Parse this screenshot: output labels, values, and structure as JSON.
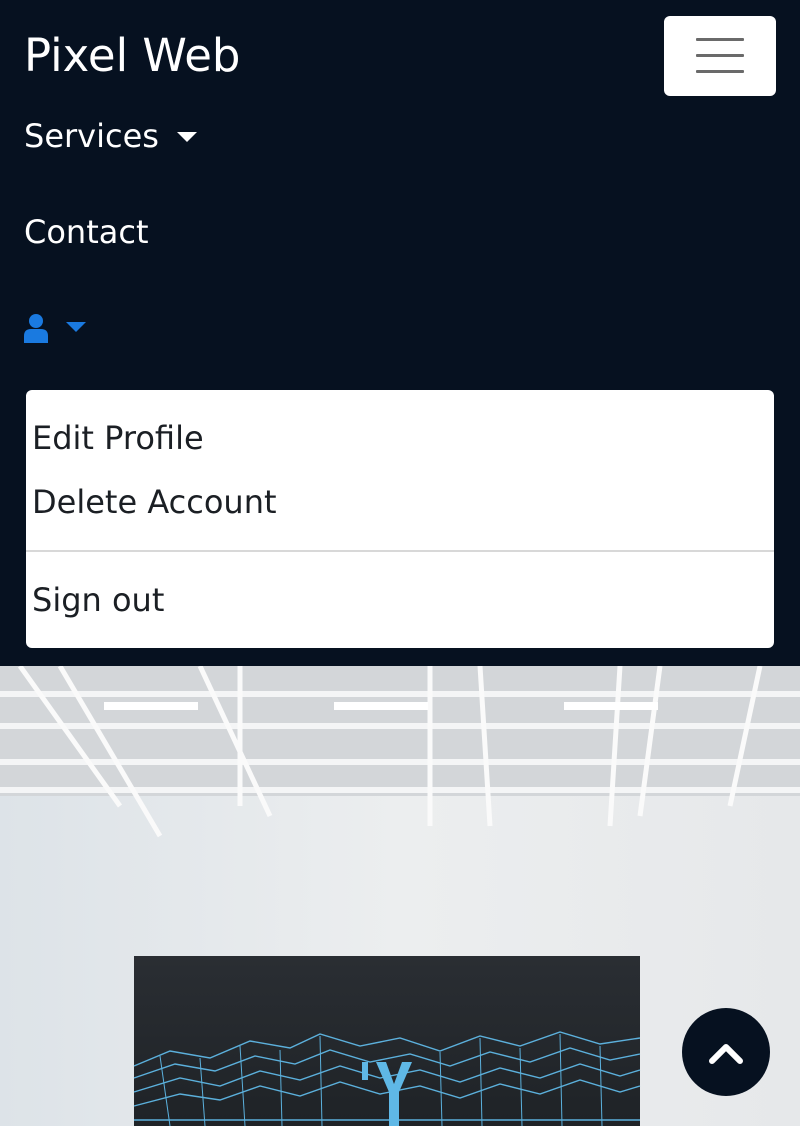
{
  "navbar": {
    "brand": "Pixel Web",
    "services_label": "Services",
    "contact_label": "Contact",
    "background": "#061120",
    "user_icon_color": "#1a7ae0"
  },
  "user_menu": {
    "edit_profile": "Edit Profile",
    "delete_account": "Delete Account",
    "sign_out": "Sign out"
  },
  "hero": {
    "image": "office-interior-with-wireframe-mountain-poster"
  },
  "icons": {
    "menu": "hamburger-icon",
    "user": "user-icon",
    "back_to_top": "chevron-up-icon"
  }
}
